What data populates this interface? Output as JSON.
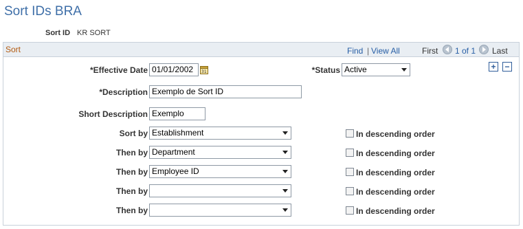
{
  "page": {
    "title": "Sort IDs BRA"
  },
  "key": {
    "label": "Sort ID",
    "value": "KR SORT"
  },
  "panel": {
    "title": "Sort",
    "nav": {
      "find": "Find",
      "separator": "|",
      "view_all": "View All",
      "first": "First",
      "count": "1 of 1",
      "last": "Last"
    },
    "buttons": {
      "add": "+",
      "remove": "−"
    }
  },
  "form": {
    "effective_date": {
      "label": "*Effective Date",
      "value": "01/01/2002"
    },
    "status": {
      "label": "*Status",
      "value": "Active"
    },
    "description": {
      "label": "*Description",
      "value": "Exemplo de Sort ID"
    },
    "short_description": {
      "label": "Short Description",
      "value": "Exemplo"
    },
    "sort_rows": [
      {
        "label": "Sort by",
        "value": "Establishment",
        "checkbox_label": "In descending order",
        "checked": false
      },
      {
        "label": "Then by",
        "value": "Department",
        "checkbox_label": "In descending order",
        "checked": false
      },
      {
        "label": "Then by",
        "value": "Employee ID",
        "checkbox_label": "In descending order",
        "checked": false
      },
      {
        "label": "Then by",
        "value": "",
        "checkbox_label": "In descending order",
        "checked": false
      },
      {
        "label": "Then by",
        "value": "",
        "checkbox_label": "In descending order",
        "checked": false
      }
    ]
  },
  "icons": {
    "calendar": "calendar-icon",
    "nav_prev": "arrow-left-icon",
    "nav_next": "arrow-right-icon",
    "dropdown": "chevron-down-icon"
  },
  "colors": {
    "title": "#3f6fa8",
    "panel_title": "#b35a10",
    "link": "#275ea5",
    "panel_header_bg": "#e9eef3",
    "border": "#c8d1da"
  }
}
